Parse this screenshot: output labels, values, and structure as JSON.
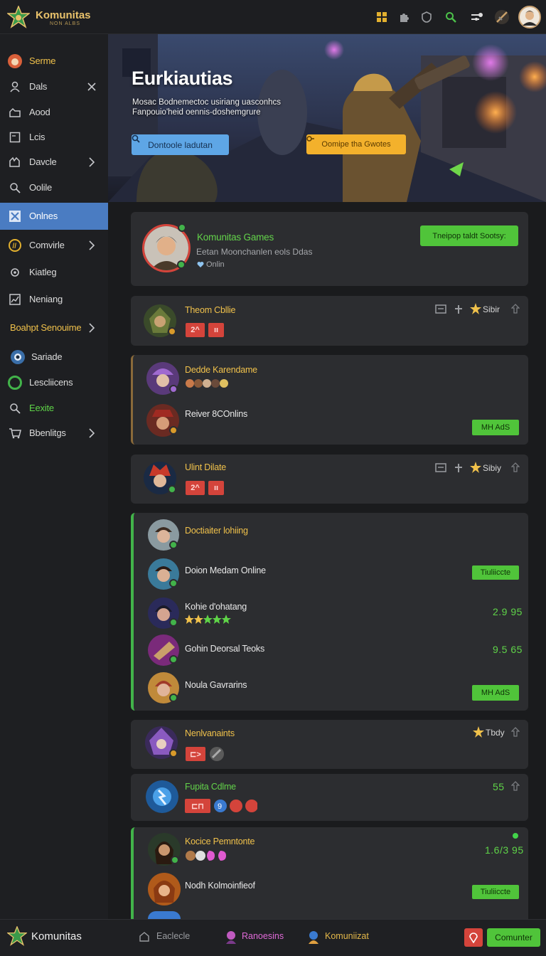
{
  "app": {
    "name": "Komunitas",
    "tagline": "NON ALBS"
  },
  "topbar_icons": [
    "grid-icon",
    "puzzle-icon",
    "shield-icon",
    "search-icon",
    "settings-icon",
    "sword-icon",
    "user-avatar"
  ],
  "sidebar": {
    "items": [
      {
        "label": "Serme",
        "icon": "fox-icon"
      },
      {
        "label": "Dals",
        "icon": "person-icon"
      },
      {
        "label": "Aood",
        "icon": "hand-icon"
      },
      {
        "label": "Lcis",
        "icon": "card-icon"
      },
      {
        "label": "Davcle",
        "icon": "hand-icon"
      },
      {
        "label": "Oolile",
        "icon": "search-icon"
      },
      {
        "label": "Onlnes",
        "icon": "cross-icon"
      },
      {
        "label": "Comvirle",
        "icon": "coin-icon"
      },
      {
        "label": "Kiatleg",
        "icon": "cog-icon"
      },
      {
        "label": "Neniang",
        "icon": "chart-icon"
      },
      {
        "label": "Boahpt Senouime",
        "icon": ""
      },
      {
        "label": "Sariade",
        "icon": "bubble-icon"
      },
      {
        "label": "Lescliicens",
        "icon": "ring-icon"
      },
      {
        "label": "Eexite",
        "icon": "search-icon"
      },
      {
        "label": "Bbenlitgs",
        "icon": "cart-icon"
      }
    ]
  },
  "hero": {
    "title": "Eurkiautias",
    "subtitle": "Mosac Bodnemectoc usiriang uasconhcs Fanpouio'heid oennis-doshemgrure",
    "button_primary": "Dontoole ladutan",
    "button_secondary": "Oomipe tha Gwotes"
  },
  "profile": {
    "name": "Komunitas Games",
    "desc": "Eetan Moonchanlen eols Ddas",
    "status": "Onlin",
    "button": "Tneipop taldt Sootsy:"
  },
  "rows": [
    {
      "name": "Theom Cbllie",
      "tag1": "2^",
      "tag2": "ıı",
      "stars": "Sibir"
    },
    {
      "name": "Dedde Karendame"
    },
    {
      "name": "Reiver 8COnlins",
      "button": "MH AdS"
    },
    {
      "name": "Ulint Dilate",
      "tag1": "2^",
      "tag2": "ıı",
      "stars": "Sibiy"
    },
    {
      "name": "Doctiaiter lohiing"
    },
    {
      "name": "Doion Medam Online",
      "button": "Tiuliiccte"
    },
    {
      "name": "Kohie d'ohatang",
      "value": "2.9 95"
    },
    {
      "name": "Gohin Deorsal Teoks",
      "value": "9.5 65"
    },
    {
      "name": "Noula Gavrarins",
      "button": "MH AdS"
    },
    {
      "name": "Nenlvanaints",
      "stars": "Tbdy",
      "tag1": "⊏>"
    },
    {
      "name": "Fupita Cdlme",
      "value": "55",
      "tag1": "⊏⊓"
    },
    {
      "name": "Kocice Pemntonte",
      "value": "1.6/3 95"
    },
    {
      "name": "Nodh Kolmoinfieof",
      "button": "Tiuliiccte"
    }
  ],
  "bottombar": {
    "brand": "Komunitas",
    "items": [
      "Eaclecle",
      "Ranoesins",
      "Komuniizat"
    ],
    "button": "Comunter"
  },
  "colors": {
    "accent_blue": "#4a7cc2",
    "green": "#50c43a",
    "gold": "#f0c14b",
    "red": "#d4443b"
  }
}
